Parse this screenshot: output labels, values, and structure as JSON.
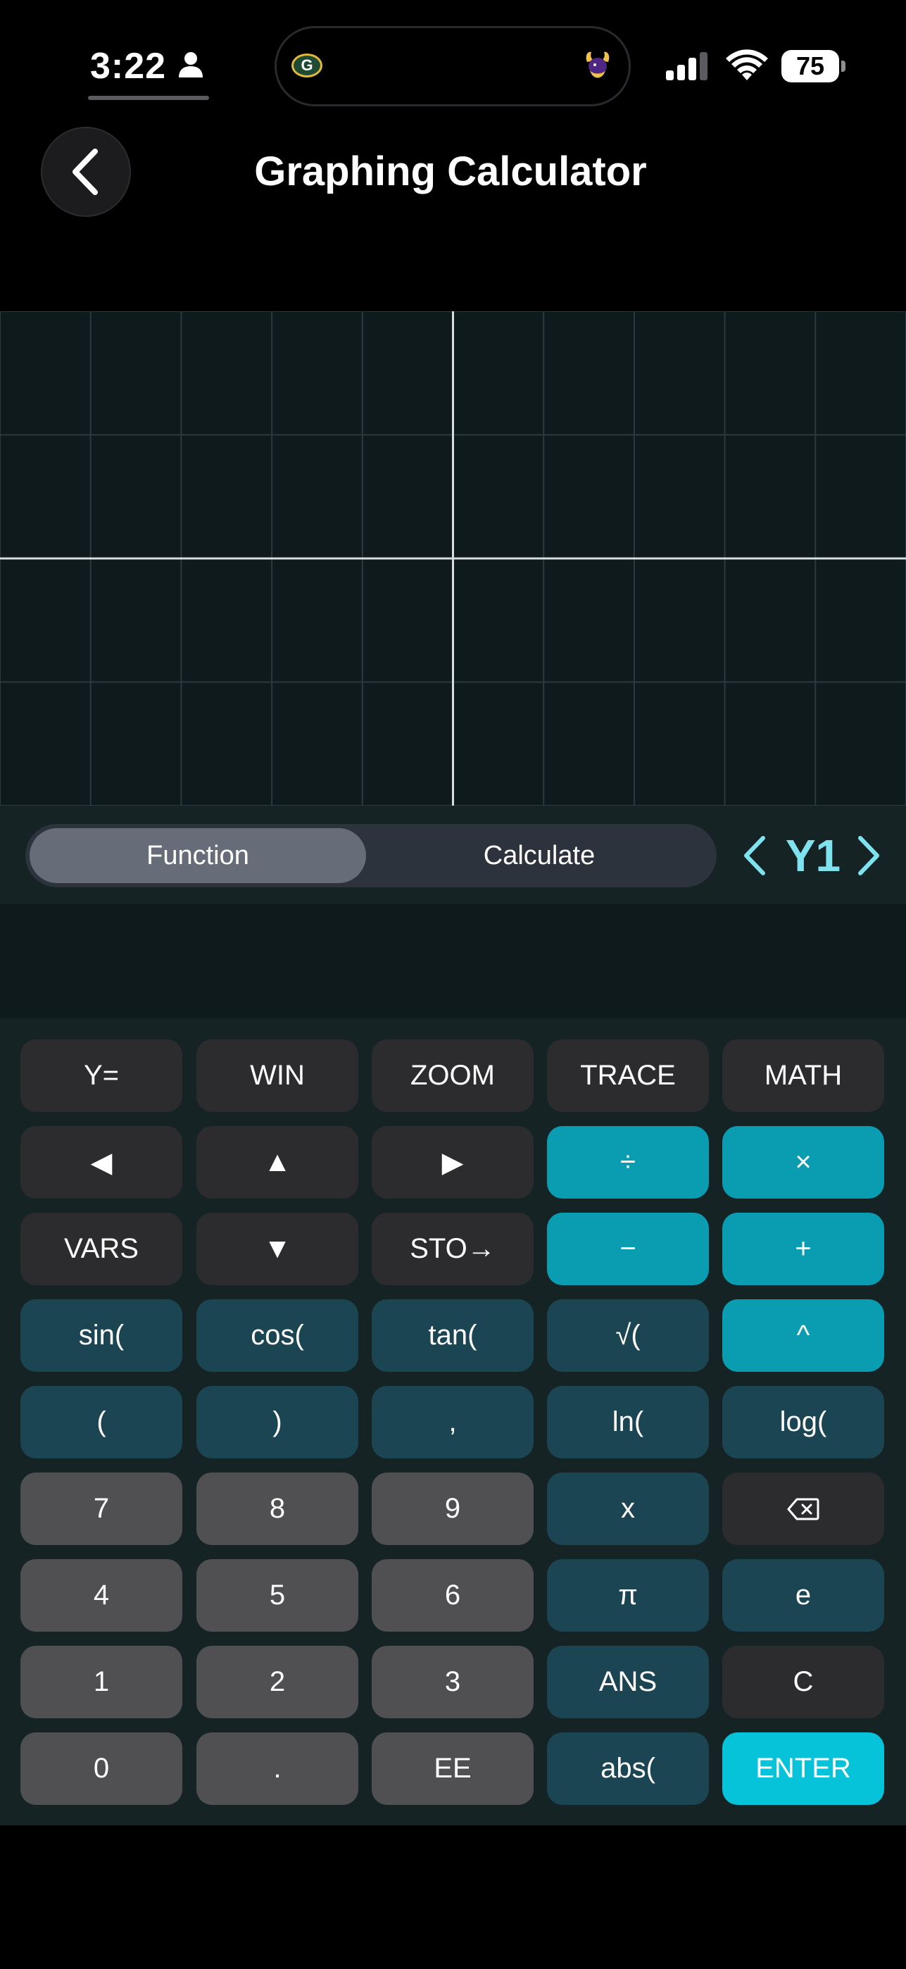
{
  "status_bar": {
    "time": "3:22",
    "battery": "75"
  },
  "header": {
    "title": "Graphing Calculator"
  },
  "graph": {
    "type": "function-plot",
    "grid": true,
    "axes": true,
    "plotted_functions": []
  },
  "mode_bar": {
    "function_label": "Function",
    "calculate_label": "Calculate",
    "active": "Function",
    "current_function": "Y1"
  },
  "display": {
    "expression": ""
  },
  "keypad": {
    "rows": [
      [
        {
          "label": "Y=",
          "style": "dark",
          "name": "y-equals"
        },
        {
          "label": "WIN",
          "style": "dark",
          "name": "win"
        },
        {
          "label": "ZOOM",
          "style": "dark",
          "name": "zoom"
        },
        {
          "label": "TRACE",
          "style": "dark",
          "name": "trace"
        },
        {
          "label": "MATH",
          "style": "dark",
          "name": "math"
        }
      ],
      [
        {
          "label": "◀",
          "style": "dark",
          "name": "left-arrow"
        },
        {
          "label": "▲",
          "style": "dark",
          "name": "up-arrow"
        },
        {
          "label": "▶",
          "style": "dark",
          "name": "right-arrow"
        },
        {
          "label": "÷",
          "style": "teal",
          "name": "divide"
        },
        {
          "label": "×",
          "style": "teal",
          "name": "multiply"
        }
      ],
      [
        {
          "label": "VARS",
          "style": "dark",
          "name": "vars"
        },
        {
          "label": "▼",
          "style": "dark",
          "name": "down-arrow"
        },
        {
          "label": "STO→",
          "style": "dark",
          "name": "store"
        },
        {
          "label": "−",
          "style": "teal",
          "name": "subtract"
        },
        {
          "label": "+",
          "style": "teal",
          "name": "add"
        }
      ],
      [
        {
          "label": "sin(",
          "style": "navy",
          "name": "sin"
        },
        {
          "label": "cos(",
          "style": "navy",
          "name": "cos"
        },
        {
          "label": "tan(",
          "style": "navy",
          "name": "tan"
        },
        {
          "label": "√(",
          "style": "navy",
          "name": "sqrt"
        },
        {
          "label": "^",
          "style": "teal",
          "name": "power"
        }
      ],
      [
        {
          "label": "(",
          "style": "navy",
          "name": "open-paren"
        },
        {
          "label": ")",
          "style": "navy",
          "name": "close-paren"
        },
        {
          "label": ",",
          "style": "navy",
          "name": "comma"
        },
        {
          "label": "ln(",
          "style": "navy",
          "name": "ln"
        },
        {
          "label": "log(",
          "style": "navy",
          "name": "log"
        }
      ],
      [
        {
          "label": "7",
          "style": "gray",
          "name": "digit-7"
        },
        {
          "label": "8",
          "style": "gray",
          "name": "digit-8"
        },
        {
          "label": "9",
          "style": "gray",
          "name": "digit-9"
        },
        {
          "label": "x",
          "style": "navy",
          "name": "variable-x"
        },
        {
          "label": "",
          "style": "dark",
          "name": "backspace",
          "icon": "backspace-icon"
        }
      ],
      [
        {
          "label": "4",
          "style": "gray",
          "name": "digit-4"
        },
        {
          "label": "5",
          "style": "gray",
          "name": "digit-5"
        },
        {
          "label": "6",
          "style": "gray",
          "name": "digit-6"
        },
        {
          "label": "π",
          "style": "navy",
          "name": "pi"
        },
        {
          "label": "e",
          "style": "navy",
          "name": "euler-e"
        }
      ],
      [
        {
          "label": "1",
          "style": "gray",
          "name": "digit-1"
        },
        {
          "label": "2",
          "style": "gray",
          "name": "digit-2"
        },
        {
          "label": "3",
          "style": "gray",
          "name": "digit-3"
        },
        {
          "label": "ANS",
          "style": "navy",
          "name": "answer"
        },
        {
          "label": "C",
          "style": "dark",
          "name": "clear"
        }
      ],
      [
        {
          "label": "0",
          "style": "gray",
          "name": "digit-0"
        },
        {
          "label": ".",
          "style": "gray",
          "name": "decimal-point"
        },
        {
          "label": "EE",
          "style": "gray",
          "name": "exponent-ee"
        },
        {
          "label": "abs(",
          "style": "navy",
          "name": "abs"
        },
        {
          "label": "ENTER",
          "style": "enter",
          "name": "enter"
        }
      ]
    ]
  }
}
